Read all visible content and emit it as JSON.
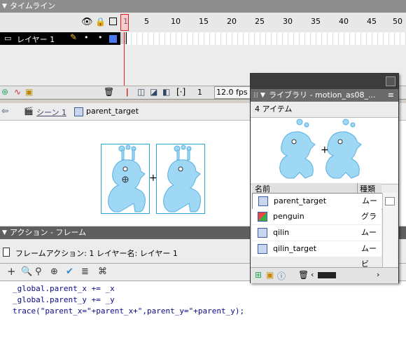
{
  "timeline": {
    "title": "タイムライン",
    "ruler": [
      "1",
      "5",
      "10",
      "15",
      "20",
      "25",
      "30",
      "35",
      "40",
      "45",
      "50"
    ],
    "layer_name": "レイヤー 1",
    "frame_number": "1",
    "fps": "12.0 fps"
  },
  "editbar": {
    "scene": "シーン 1",
    "symbol": "parent_target"
  },
  "actions": {
    "title": "アクション - フレーム",
    "info": "フレームアクション: 1 レイヤー名: レイヤー 1",
    "code": [
      "_global.parent_x += _x",
      "_global.parent_y += _y",
      "trace(\"parent_x=\"+parent_x+\",parent_y=\"+parent_y);"
    ]
  },
  "library": {
    "title": "ライブラリ - motion_as08_...",
    "count": "4 アイテム",
    "col_name": "名前",
    "col_type": "種類",
    "items": [
      {
        "name": "parent_target",
        "type": "ムービ"
      },
      {
        "name": "penguin",
        "type": "グラフィ"
      },
      {
        "name": "qilin",
        "type": "ムービ"
      },
      {
        "name": "qilin_target",
        "type": "ムービ"
      }
    ]
  },
  "colors": {
    "accent": "#29a3d4",
    "creature": "#9fd8f5",
    "playhead": "#e02020"
  }
}
